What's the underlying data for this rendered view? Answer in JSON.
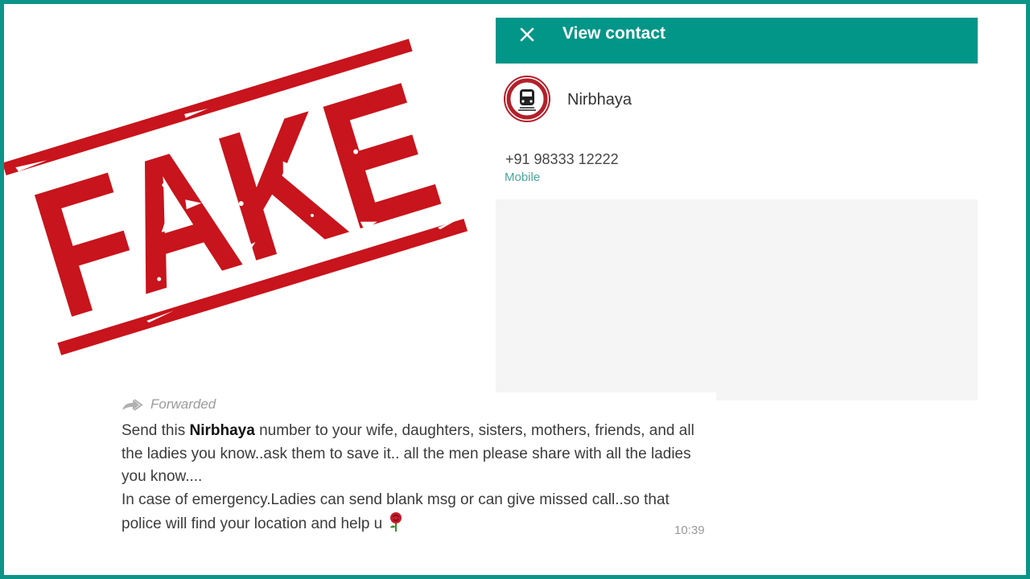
{
  "stamp": {
    "text": "FAKE",
    "color": "#c8141c"
  },
  "contact_panel": {
    "title": "View contact",
    "header_color": "#029688",
    "close_icon": "close-icon",
    "avatar_icon": "train-logo-icon",
    "name": "Nirbhaya",
    "phone": "+91 98333 12222",
    "phone_type": "Mobile"
  },
  "message": {
    "forwarded_label": "Forwarded",
    "forwarded_icon": "forward-arrow-icon",
    "line1_pre": "Send this ",
    "line1_bold": "Nirbhaya",
    "line1_post": " number to your wife, daughters, sisters, mothers, friends, and all the ladies you know..ask them to save it.. all the men please share with all the ladies you know....",
    "line2": "In case of emergency.Ladies can send blank msg or can give missed call..so that police will find your location and help u",
    "emoji_icon": "rose-icon",
    "time": "10:39"
  },
  "frame_color": "#0d9488"
}
